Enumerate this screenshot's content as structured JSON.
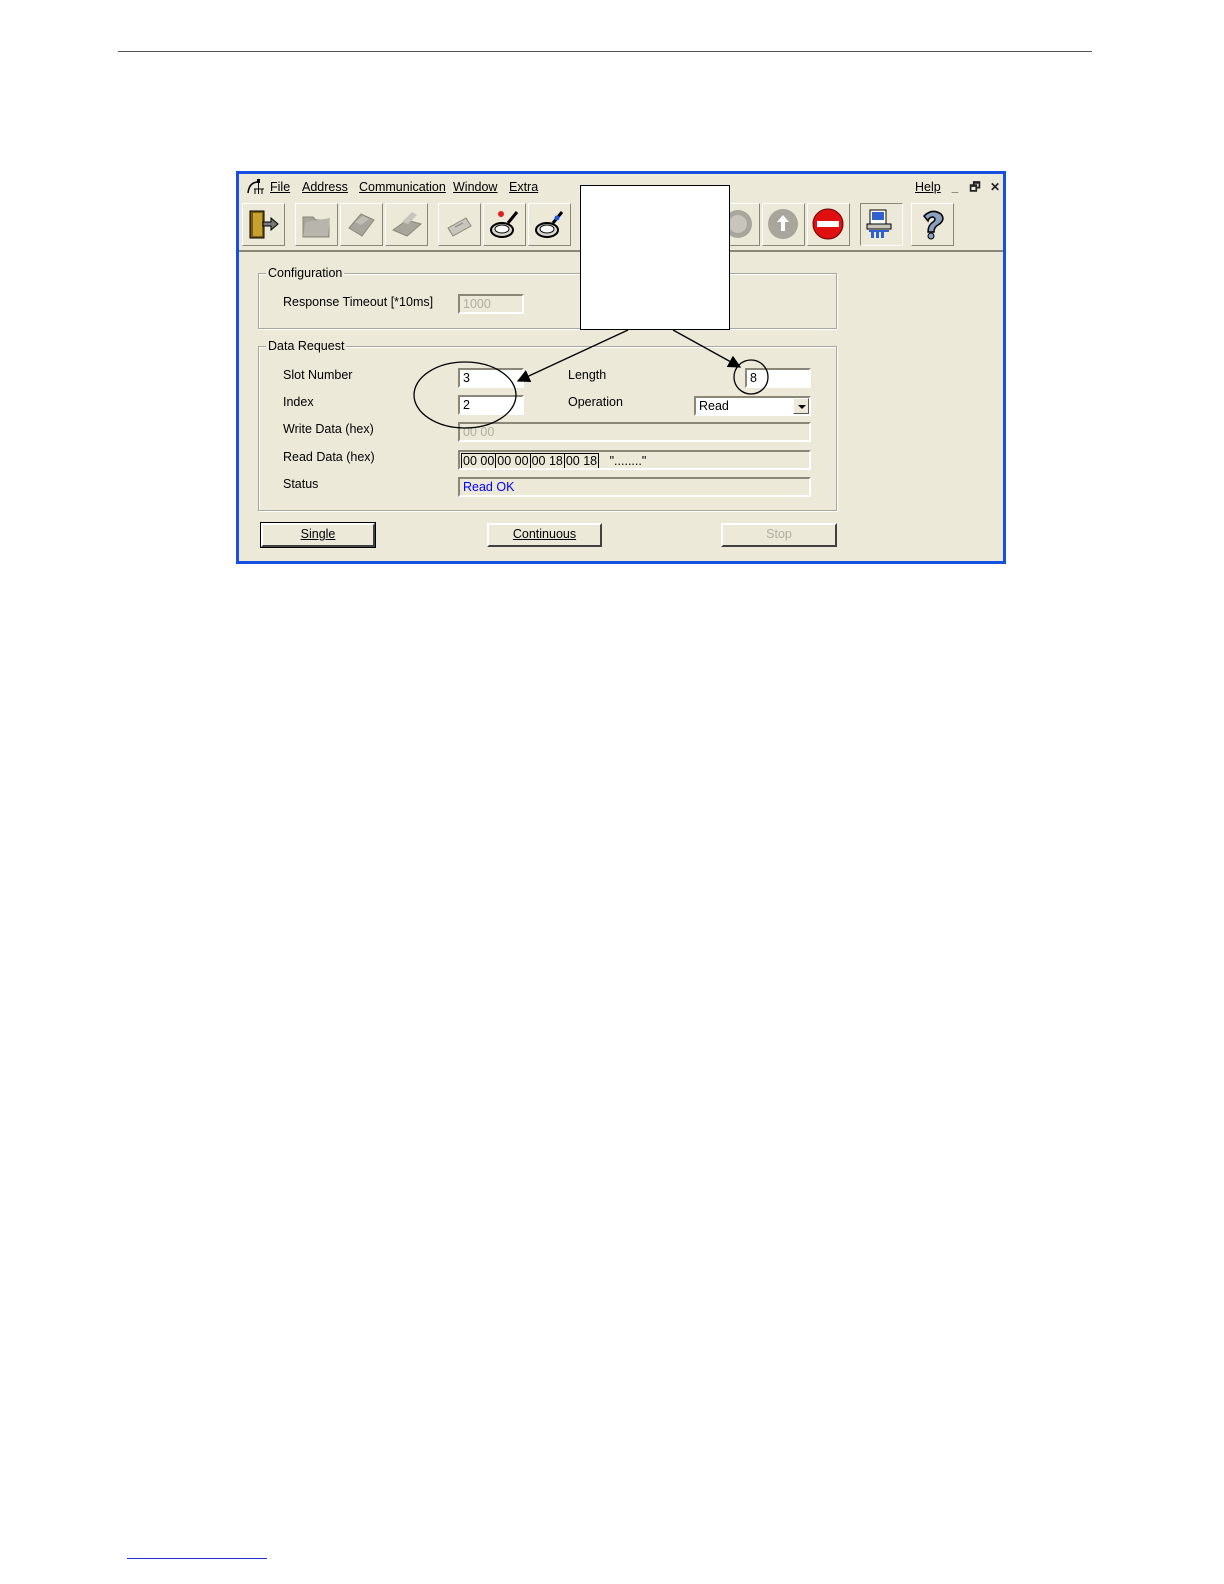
{
  "menu": {
    "file": "File",
    "address": "Address",
    "communication": "Communication",
    "window": "Window",
    "extra": "Extra",
    "help": "Help"
  },
  "window_controls": {
    "minimize": "_",
    "restore": "🗗",
    "close": "✕"
  },
  "toolbar": {
    "icons": [
      "exit-door-icon",
      "open-folder-icon",
      "save-icon",
      "print-icon",
      "envelope-icon",
      "search-red-icon",
      "search-blue-icon",
      "circle-icon",
      "upload-arrow-icon",
      "stop-icon",
      "network-config-icon",
      "help-question-icon"
    ]
  },
  "configuration": {
    "legend": "Configuration",
    "response_timeout_label": "Response Timeout [*10ms]",
    "response_timeout_value": "1000"
  },
  "data_request": {
    "legend": "Data Request",
    "slot_number_label": "Slot Number",
    "slot_number_value": "3",
    "length_label": "Length",
    "length_value": "8",
    "index_label": "Index",
    "index_value": "2",
    "operation_label": "Operation",
    "operation_value": "Read",
    "write_data_label": "Write Data (hex)",
    "write_data_value": "00 00",
    "read_data_label": "Read Data (hex)",
    "read_data_bytes": [
      "00 00",
      "00 00",
      "00 18",
      "00 18"
    ],
    "read_data_ascii": "\"........\"",
    "status_label": "Status",
    "status_value": "Read OK"
  },
  "buttons": {
    "single": "Single",
    "continuous": "Continuous",
    "stop": "Stop"
  },
  "colors": {
    "window_border": "#1650e0",
    "status_text": "#0000ff",
    "stop_icon": "#e01010"
  }
}
